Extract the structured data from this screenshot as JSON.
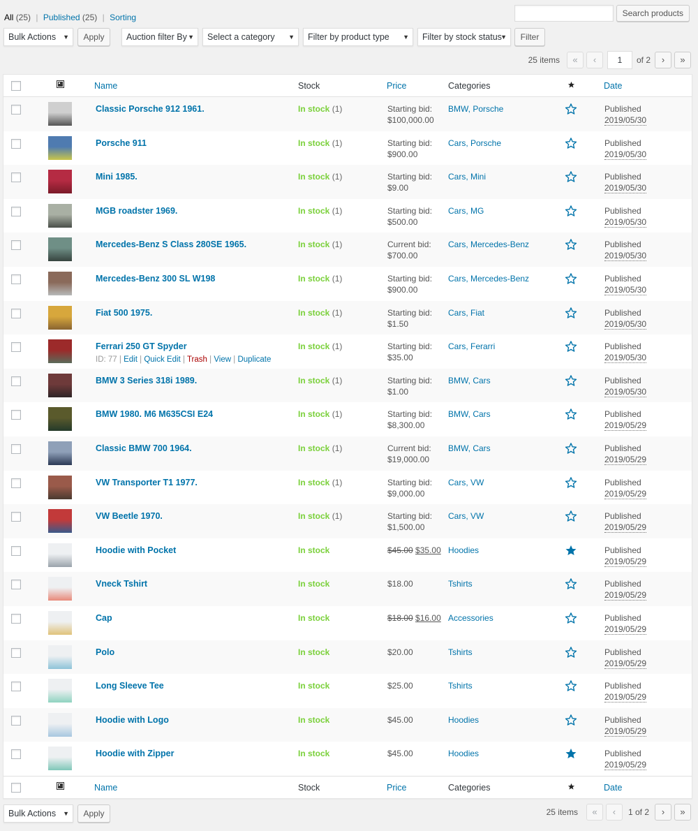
{
  "views": {
    "all_label": "All",
    "all_count": "(25)",
    "published_label": "Published",
    "published_count": "(25)",
    "sorting_label": "Sorting",
    "separator": "|"
  },
  "search": {
    "button_label": "Search products",
    "value": ""
  },
  "filters": {
    "bulk_actions": "Bulk Actions",
    "apply_label": "Apply",
    "auction_filter": "Auction filter By",
    "category": "Select a category",
    "product_type": "Filter by product type",
    "stock_status": "Filter by stock status",
    "filter_label": "Filter"
  },
  "pagination": {
    "items_label": "25 items",
    "first": "«",
    "prev": "‹",
    "next": "›",
    "last": "»",
    "current_page": "1",
    "of_label": "of 2",
    "bottom_label": "1 of 2"
  },
  "columns": {
    "name": "Name",
    "stock": "Stock",
    "price": "Price",
    "categories": "Categories",
    "featured_icon": "star-icon",
    "thumb_icon": "image-icon",
    "date": "Date"
  },
  "colors": {
    "link": "#0073aa",
    "instock": "#7ad03a",
    "trash": "#a00000",
    "star": "#0073aa"
  },
  "row_actions": {
    "id_text": "ID: 77 |",
    "edit": "Edit",
    "quick_edit": "Quick Edit",
    "trash": "Trash",
    "view": "View",
    "duplicate": "Duplicate",
    "sep": "|"
  },
  "products": [
    {
      "name": "Classic Porsche 912 1961.",
      "stock": "In stock",
      "qty": "(1)",
      "price_label": "Starting bid:",
      "price": "$100,000.00",
      "categories": "BMW, Porsche",
      "featured": false,
      "status": "Published",
      "date": "2019/05/30",
      "thumb": [
        "#cfcfcf",
        "#555555"
      ]
    },
    {
      "name": "Porsche 911",
      "stock": "In stock",
      "qty": "(1)",
      "price_label": "Starting bid:",
      "price": "$900.00",
      "categories": "Cars, Porsche",
      "featured": false,
      "status": "Published",
      "date": "2019/05/30",
      "thumb": [
        "#4f7bb0",
        "#c9c64a"
      ]
    },
    {
      "name": "Mini 1985.",
      "stock": "In stock",
      "qty": "(1)",
      "price_label": "Starting bid:",
      "price": "$9.00",
      "categories": "Cars, Mini",
      "featured": false,
      "status": "Published",
      "date": "2019/05/30",
      "thumb": [
        "#b52b43",
        "#7a1a28"
      ]
    },
    {
      "name": "MGB roadster 1969.",
      "stock": "In stock",
      "qty": "(1)",
      "price_label": "Starting bid:",
      "price": "$500.00",
      "categories": "Cars, MG",
      "featured": false,
      "status": "Published",
      "date": "2019/05/30",
      "thumb": [
        "#a9b0a4",
        "#4a4f49"
      ]
    },
    {
      "name": "Mercedes-Benz S Class 280SE 1965.",
      "stock": "In stock",
      "qty": "(1)",
      "price_label": "Current bid:",
      "price": "$700.00",
      "categories": "Cars, Mercedes-Benz",
      "featured": false,
      "status": "Published",
      "date": "2019/05/30",
      "thumb": [
        "#6f8f86",
        "#36443f"
      ]
    },
    {
      "name": "Mercedes-Benz 300 SL W198",
      "stock": "In stock",
      "qty": "(1)",
      "price_label": "Starting bid:",
      "price": "$900.00",
      "categories": "Cars, Mercedes-Benz",
      "featured": false,
      "status": "Published",
      "date": "2019/05/30",
      "thumb": [
        "#8a6a5a",
        "#b7b9b9"
      ]
    },
    {
      "name": "Fiat 500 1975.",
      "stock": "In stock",
      "qty": "(1)",
      "price_label": "Starting bid:",
      "price": "$1.50",
      "categories": "Cars, Fiat",
      "featured": false,
      "status": "Published",
      "date": "2019/05/30",
      "thumb": [
        "#d7a73c",
        "#8a6431"
      ]
    },
    {
      "name": "Ferrari 250 GT Spyder",
      "stock": "In stock",
      "qty": "(1)",
      "price_label": "Starting bid:",
      "price": "$35.00",
      "categories": "Cars, Ferarri",
      "featured": false,
      "status": "Published",
      "date": "2019/05/30",
      "thumb": [
        "#9c2a2a",
        "#5a6b5a"
      ],
      "hovered": true
    },
    {
      "name": "BMW 3 Series 318i 1989.",
      "stock": "In stock",
      "qty": "(1)",
      "price_label": "Starting bid:",
      "price": "$1.00",
      "categories": "BMW, Cars",
      "featured": false,
      "status": "Published",
      "date": "2019/05/30",
      "thumb": [
        "#6e3a3a",
        "#2e2426"
      ]
    },
    {
      "name": "BMW 1980. M6 M635CSI E24",
      "stock": "In stock",
      "qty": "(1)",
      "price_label": "Starting bid:",
      "price": "$8,300.00",
      "categories": "BMW, Cars",
      "featured": false,
      "status": "Published",
      "date": "2019/05/29",
      "thumb": [
        "#5a5a2c",
        "#243a2a"
      ]
    },
    {
      "name": "Classic BMW 700 1964.",
      "stock": "In stock",
      "qty": "(1)",
      "price_label": "Current bid:",
      "price": "$19,000.00",
      "categories": "BMW, Cars",
      "featured": false,
      "status": "Published",
      "date": "2019/05/29",
      "thumb": [
        "#8fa0b8",
        "#2c3a56"
      ]
    },
    {
      "name": "VW Transporter T1 1977.",
      "stock": "In stock",
      "qty": "(1)",
      "price_label": "Starting bid:",
      "price": "$9,000.00",
      "categories": "Cars, VW",
      "featured": false,
      "status": "Published",
      "date": "2019/05/29",
      "thumb": [
        "#9a5a4a",
        "#4a3a30"
      ]
    },
    {
      "name": "VW Beetle 1970.",
      "stock": "In stock",
      "qty": "(1)",
      "price_label": "Starting bid:",
      "price": "$1,500.00",
      "categories": "Cars, VW",
      "featured": false,
      "status": "Published",
      "date": "2019/05/29",
      "thumb": [
        "#c23a3a",
        "#3a5a8a"
      ]
    },
    {
      "name": "Hoodie with Pocket",
      "stock": "In stock",
      "qty": "",
      "price_label": "",
      "price_old": "$45.00",
      "price": "$35.00",
      "categories": "Hoodies",
      "featured": true,
      "status": "Published",
      "date": "2019/05/29",
      "thumb": [
        "#eef0f2",
        "#9aa3ab"
      ]
    },
    {
      "name": "Vneck Tshirt",
      "stock": "In stock",
      "qty": "",
      "price_label": "",
      "price": "$18.00",
      "categories": "Tshirts",
      "featured": false,
      "status": "Published",
      "date": "2019/05/29",
      "thumb": [
        "#eef0f2",
        "#e88a7a"
      ]
    },
    {
      "name": "Cap",
      "stock": "In stock",
      "qty": "",
      "price_label": "",
      "price_old": "$18.00",
      "price": "$16.00",
      "categories": "Accessories",
      "featured": false,
      "status": "Published",
      "date": "2019/05/29",
      "thumb": [
        "#eef0f2",
        "#e0c27a"
      ]
    },
    {
      "name": "Polo",
      "stock": "In stock",
      "qty": "",
      "price_label": "",
      "price": "$20.00",
      "categories": "Tshirts",
      "featured": false,
      "status": "Published",
      "date": "2019/05/29",
      "thumb": [
        "#eef0f2",
        "#8ec3d8"
      ]
    },
    {
      "name": "Long Sleeve Tee",
      "stock": "In stock",
      "qty": "",
      "price_label": "",
      "price": "$25.00",
      "categories": "Tshirts",
      "featured": false,
      "status": "Published",
      "date": "2019/05/29",
      "thumb": [
        "#eef0f2",
        "#8fd3c0"
      ]
    },
    {
      "name": "Hoodie with Logo",
      "stock": "In stock",
      "qty": "",
      "price_label": "",
      "price": "$45.00",
      "categories": "Hoodies",
      "featured": false,
      "status": "Published",
      "date": "2019/05/29",
      "thumb": [
        "#eef0f2",
        "#a7c7e0"
      ]
    },
    {
      "name": "Hoodie with Zipper",
      "stock": "In stock",
      "qty": "",
      "price_label": "",
      "price": "$45.00",
      "categories": "Hoodies",
      "featured": true,
      "status": "Published",
      "date": "2019/05/29",
      "thumb": [
        "#eef0f2",
        "#7fc7b8"
      ]
    }
  ]
}
